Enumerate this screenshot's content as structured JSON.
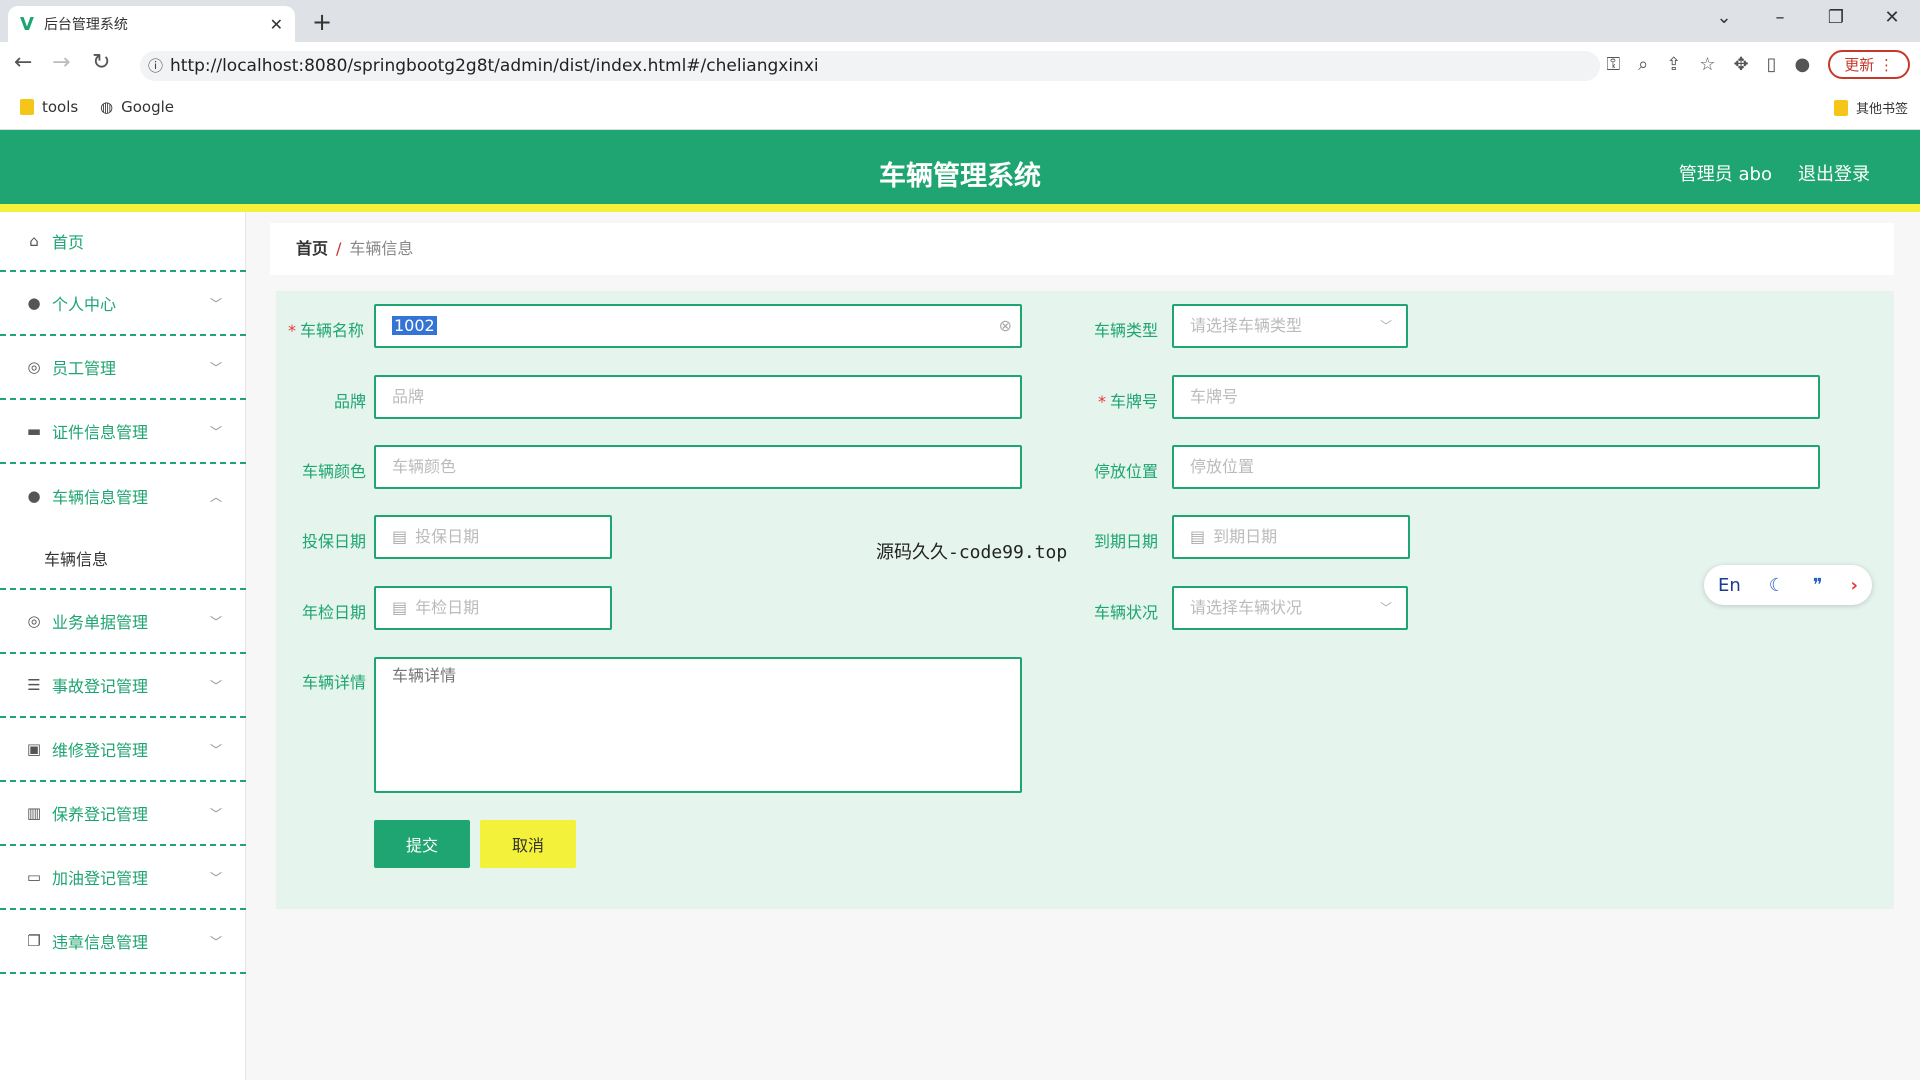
{
  "browser": {
    "tab_title": "后台管理系统",
    "url": "http://localhost:8080/springbootg2g8t/admin/dist/index.html#/cheliangxinxi",
    "update_label": "更新",
    "bookmarks": [
      "tools",
      "Google"
    ],
    "other_bookmarks": "其他书签"
  },
  "header": {
    "title": "车辆管理系统",
    "user": "管理员 abo",
    "logout": "退出登录"
  },
  "sidebar": {
    "items": [
      {
        "label": "首页",
        "icon": "home-icon"
      },
      {
        "label": "个人中心",
        "icon": "user-icon"
      },
      {
        "label": "员工管理",
        "icon": "compass-icon"
      },
      {
        "label": "证件信息管理",
        "icon": "card-icon"
      },
      {
        "label": "车辆信息管理",
        "icon": "user-icon"
      },
      {
        "label": "业务单据管理",
        "icon": "compass-icon"
      },
      {
        "label": "事故登记管理",
        "icon": "sliders-icon"
      },
      {
        "label": "维修登记管理",
        "icon": "briefcase-icon"
      },
      {
        "label": "保养登记管理",
        "icon": "bar-chart-icon"
      },
      {
        "label": "加油登记管理",
        "icon": "chat-icon"
      },
      {
        "label": "违章信息管理",
        "icon": "copy-icon"
      }
    ],
    "submenu": "车辆信息"
  },
  "breadcrumb": {
    "home": "首页",
    "separator": "/",
    "current": "车辆信息"
  },
  "form": {
    "name": {
      "label": "车辆名称",
      "value": "1002"
    },
    "type": {
      "label": "车辆类型",
      "placeholder": "请选择车辆类型"
    },
    "brand": {
      "label": "品牌",
      "placeholder": "品牌"
    },
    "plate": {
      "label": "车牌号",
      "placeholder": "车牌号"
    },
    "color": {
      "label": "车辆颜色",
      "placeholder": "车辆颜色"
    },
    "location": {
      "label": "停放位置",
      "placeholder": "停放位置"
    },
    "insure_date": {
      "label": "投保日期",
      "placeholder": "投保日期"
    },
    "expire_date": {
      "label": "到期日期",
      "placeholder": "到期日期"
    },
    "inspect_date": {
      "label": "年检日期",
      "placeholder": "年检日期"
    },
    "status": {
      "label": "车辆状况",
      "placeholder": "请选择车辆状况"
    },
    "detail": {
      "label": "车辆详情",
      "placeholder": "车辆详情"
    },
    "submit": "提交",
    "cancel": "取消"
  },
  "overlay_text": "源码久久-code99.top",
  "float_tool": {
    "lang": "En"
  },
  "colors": {
    "primary": "#1ea571",
    "accent_yellow": "#f3f13a",
    "required": "#e53935"
  }
}
